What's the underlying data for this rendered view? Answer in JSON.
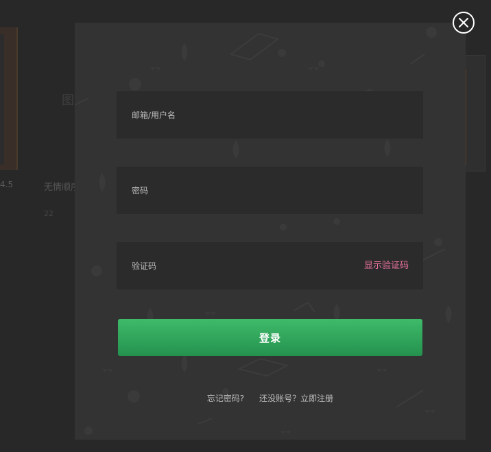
{
  "background": {
    "rating": "4.5",
    "title": "无情顺序",
    "subtitle": "22"
  },
  "login_form": {
    "email_placeholder": "邮箱/用户名",
    "password_placeholder": "密码",
    "captcha_placeholder": "验证码",
    "show_captcha_label": "显示验证码",
    "login_button_label": "登录",
    "forgot_password_label": "忘记密码?",
    "register_label": "还没账号？立即注册"
  },
  "colors": {
    "accent_pink": "#e7719c",
    "login_green_top": "#3fba6a",
    "login_green_bottom": "#24924e",
    "modal_bg": "#333333",
    "field_bg": "#2b2b2b"
  },
  "icons": {
    "close": "close-icon"
  }
}
